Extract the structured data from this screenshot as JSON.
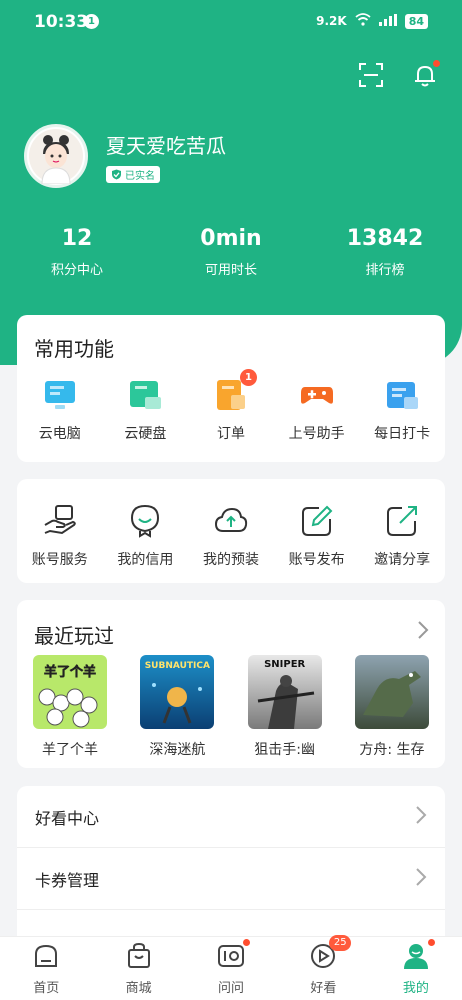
{
  "status_bar": {
    "time": "10:33",
    "notification_count": "1",
    "network_speed": "9.2K",
    "battery": "84"
  },
  "profile": {
    "name": "夏天爱吃苦瓜",
    "verified_label": "已实名"
  },
  "stats": [
    {
      "value": "12",
      "label": "积分中心"
    },
    {
      "value": "0min",
      "label": "可用时长"
    },
    {
      "value": "13842",
      "label": "排行榜"
    }
  ],
  "common_functions": {
    "title": "常用功能",
    "items": [
      {
        "label": "云电脑",
        "icon": "cloud-pc-icon"
      },
      {
        "label": "云硬盘",
        "icon": "cloud-disk-icon"
      },
      {
        "label": "订单",
        "icon": "order-icon",
        "badge": "1"
      },
      {
        "label": "上号助手",
        "icon": "gamepad-icon"
      },
      {
        "label": "每日打卡",
        "icon": "checkin-icon"
      }
    ]
  },
  "services": {
    "items": [
      {
        "label": "账号服务",
        "icon": "account-service-icon"
      },
      {
        "label": "我的信用",
        "icon": "credit-icon"
      },
      {
        "label": "我的预装",
        "icon": "cloud-upload-icon"
      },
      {
        "label": "账号发布",
        "icon": "edit-icon"
      },
      {
        "label": "邀请分享",
        "icon": "share-icon"
      }
    ]
  },
  "recent_played": {
    "title": "最近玩过",
    "games": [
      {
        "label": "羊了个羊",
        "cover_text": "羊了个羊"
      },
      {
        "label": "深海迷航",
        "cover_text": "SUBNAUTICA"
      },
      {
        "label": "狙击手:幽",
        "cover_text": "SNIPER"
      },
      {
        "label": "方舟: 生存",
        "cover_text": ""
      }
    ]
  },
  "menu": [
    {
      "label": "好看中心"
    },
    {
      "label": "卡券管理"
    }
  ],
  "tabs": [
    {
      "label": "首页"
    },
    {
      "label": "商城"
    },
    {
      "label": "问问"
    },
    {
      "label": "好看",
      "badge": "25"
    },
    {
      "label": "我的"
    }
  ],
  "colors": {
    "accent": "#1fb384",
    "badge": "#ff5a3c"
  }
}
